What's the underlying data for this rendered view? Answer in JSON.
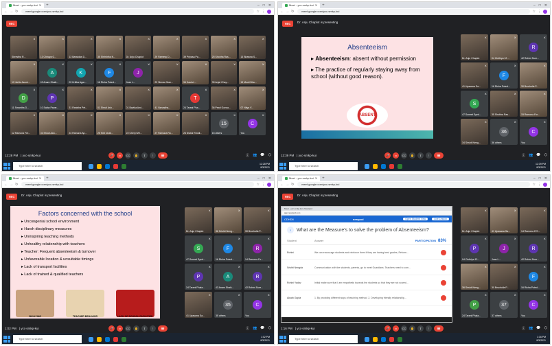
{
  "browser": {
    "tab_title": "Meet - ycc-smkp-kui",
    "url": "meet.google.com/ycc-smkp-kui"
  },
  "meet": {
    "rec_label": "REC",
    "meeting_code": "ycc-smkp-kui",
    "presenting_text": "Dr. Anju Chaplot is presenting"
  },
  "taskbar": {
    "search_placeholder": "Type here to search"
  },
  "quad1": {
    "time": "12:28 PM",
    "clock_time": "12:28 PM",
    "clock_date": "8/3/2021",
    "tiles": [
      {
        "name": "Shrestha R...",
        "kind": "photo"
      },
      {
        "name": "13 Chhaya G...",
        "kind": "photo2"
      },
      {
        "name": "13 Bansidas D...",
        "kind": "photo"
      },
      {
        "name": "35 Shrishtha N...",
        "kind": "photo2"
      },
      {
        "name": "Dr. Anju Chaplot",
        "kind": "photo"
      },
      {
        "name": "29 Ramesy D...",
        "kind": "photo2"
      },
      {
        "name": "39 Priyasa Pa...",
        "kind": "photo"
      },
      {
        "name": "25 Shobha Ras...",
        "kind": "photo2"
      },
      {
        "name": "13 Bhawna S...",
        "kind": "photo"
      },
      {
        "name": "19 Jerifa Jacob...",
        "kind": "photo2"
      },
      {
        "name": "43 Anam Shaik...",
        "kind": "letter",
        "letter": "A",
        "color": "#1a8a7a"
      },
      {
        "name": "03 Kritika Agar...",
        "kind": "letter",
        "letter": "K",
        "color": "#12a4af"
      },
      {
        "name": "16 Richa Poted...",
        "kind": "letter",
        "letter": "F",
        "color": "#1e88e5"
      },
      {
        "name": "Joan L...",
        "kind": "letter",
        "letter": "J",
        "color": "#8e24aa"
      },
      {
        "name": "22 Simran Man...",
        "kind": "photo"
      },
      {
        "name": "34 Kashvi ...",
        "kind": "photo2"
      },
      {
        "name": "05 Anjal Chay...",
        "kind": "photo"
      },
      {
        "name": "13 Mouli Bha...",
        "kind": "photo2"
      },
      {
        "name": "11 Smantha D...",
        "kind": "letter",
        "letter": "D",
        "color": "#43a047"
      },
      {
        "name": "10 Saiba Pavar...",
        "kind": "letter",
        "letter": "P",
        "color": "#5e35b1"
      },
      {
        "name": "31 Ranisha Pet...",
        "kind": "photo"
      },
      {
        "name": "01 Shruti Ash...",
        "kind": "photo2"
      },
      {
        "name": "01 Bavika And...",
        "kind": "photo"
      },
      {
        "name": "41 Narvadha...",
        "kind": "photo2"
      },
      {
        "name": "24 Tarani Pha...",
        "kind": "letter",
        "letter": "T",
        "color": "#e53935"
      },
      {
        "name": "36 Pearl Gonsa...",
        "kind": "photo"
      },
      {
        "name": "07 Nitya V...",
        "kind": "photo2"
      },
      {
        "name": "12 Ramona Fer...",
        "kind": "photo"
      },
      {
        "name": "02 Shruti Aan...",
        "kind": "photo2"
      },
      {
        "name": "24 Ramona Ap...",
        "kind": "photo"
      },
      {
        "name": "25 Kirti Chah...",
        "kind": "photo2"
      },
      {
        "name": "22 Cheryl Wr...",
        "kind": "photo"
      },
      {
        "name": "27 Ramona Ro...",
        "kind": "photo2"
      },
      {
        "name": "26 Ilmani Reddi...",
        "kind": "photo"
      },
      {
        "name": "15 others",
        "kind": "letter",
        "letter": "15",
        "color": "#5f6368"
      },
      {
        "name": "You",
        "kind": "letter",
        "letter": "C",
        "color": "#9334e6"
      }
    ]
  },
  "quad2": {
    "time": "12:39 PM",
    "clock_time": "12:39 PM",
    "clock_date": "8/3/2021",
    "slide_title": "Absenteeism",
    "bullet1_term": "Absenteeism",
    "bullet1_rest": ": absent without permission",
    "bullet2": "The practice of regularly staying away from school (without good reason).",
    "absent_label": "ABSENT",
    "side_tiles": [
      {
        "name": "Dr. Anju Chaplot",
        "kind": "photo"
      },
      {
        "name": "04 Cinthiya 12 ...",
        "kind": "photo2"
      },
      {
        "name": "42 Rohini Sure...",
        "kind": "letter",
        "letter": "R",
        "color": "#5e35b1"
      },
      {
        "name": "41 Upasana Sa...",
        "kind": "photo"
      },
      {
        "name": "16 Richa Poted...",
        "kind": "letter",
        "letter": "F",
        "color": "#1e88e5"
      },
      {
        "name": "30 Bruchulla P...",
        "kind": "photo2"
      },
      {
        "name": "47 Suneet Syed...",
        "kind": "letter",
        "letter": "S",
        "color": "#34a853"
      },
      {
        "name": "35 Shobha Ras...",
        "kind": "photo"
      },
      {
        "name": "15 Ramona For...",
        "kind": "photo2"
      },
      {
        "name": "34 Srishti Neng...",
        "kind": "photo"
      },
      {
        "name": "36 others",
        "kind": "letter",
        "letter": "36",
        "color": "#5f6368"
      },
      {
        "name": "You",
        "kind": "letter",
        "letter": "C",
        "color": "#9334e6"
      }
    ]
  },
  "quad3": {
    "time": "1:02 PM",
    "clock_time": "1:02 PM",
    "clock_date": "8/3/2021",
    "slide_title": "Factors concerned with the school",
    "bullets": [
      "Uncongenial school environment",
      "Harsh disciplinary measures",
      "Uninspiring teaching methods",
      "Unhealthy relationship with teachers",
      "Teacher: Frequent absenteeism & turnover",
      "Unfavorable location & unsuitable timings",
      "Lack of transport facilities",
      "Lack of trained & qualified teachers"
    ],
    "captions": [
      "BULLYING",
      "TEACHER BEHAVIOR",
      "LACK OF SCHOOL FACILITIES"
    ],
    "side_tiles": [
      {
        "name": "Dr. Anju Chaplot",
        "kind": "photo"
      },
      {
        "name": "36 Srishti Neng...",
        "kind": "photo2"
      },
      {
        "name": "30 Bruchulla P...",
        "kind": "photo"
      },
      {
        "name": "47 Suneet Syed...",
        "kind": "letter",
        "letter": "S",
        "color": "#34a853"
      },
      {
        "name": "16 Richa Poted...",
        "kind": "letter",
        "letter": "F",
        "color": "#1e88e5"
      },
      {
        "name": "14 Ramona Fo...",
        "kind": "letter",
        "letter": "R",
        "color": "#8e24aa"
      },
      {
        "name": "24 Tarani Phala...",
        "kind": "letter",
        "letter": "P",
        "color": "#5e35b1"
      },
      {
        "name": "43 Anam Shaik...",
        "kind": "letter",
        "letter": "A",
        "color": "#1a8a7a"
      },
      {
        "name": "42 Rohini Sure...",
        "kind": "letter",
        "letter": "R",
        "color": "#5e35b1"
      },
      {
        "name": "41 Upasana Sa...",
        "kind": "photo"
      },
      {
        "name": "35 others",
        "kind": "letter",
        "letter": "35",
        "color": "#5f6368"
      },
      {
        "name": "You",
        "kind": "letter",
        "letter": "C",
        "color": "#9334e6"
      }
    ]
  },
  "quad4": {
    "time": "1:16 PM",
    "clock_time": "1:16 PM",
    "clock_date": "8/3/2021",
    "inner_tabs": "Meet - ycc-smkp-kui | Nearpod",
    "inner_url": "app.nearpod.com",
    "inner_code": "CDHD8",
    "nearpod_logo": "nearpod",
    "inner_btn1": "Open Student View",
    "inner_btn2": "Live Lesson",
    "question": "What are the Measure's to solve the problem of Absenteeism?",
    "col_student": "Student",
    "col_answer": "Answer",
    "participation_label": "PARTICIPATION",
    "participation_pct": "83%",
    "rows": [
      {
        "student": "Rohini",
        "answer": "We can encourage students and reinforce them if they are having best grades, Reform..."
      },
      {
        "student": "Srishti Nengda",
        "answer": "Communication with the students, parents, go to meet Guardians. Teachers need to com..."
      },
      {
        "student": "Rohini Yadav",
        "answer": "Initial make sure that I am empathetic towards the students so that they are not scared..."
      },
      {
        "student": "Aksah Gupta",
        "answer": "1. By providing different ways of teaching method. 2. Developing friendly relationship..."
      }
    ],
    "side_tiles": [
      {
        "name": "Dr. Anju Chaplot",
        "kind": "photo"
      },
      {
        "name": "41 Upasana Sa...",
        "kind": "photo2"
      },
      {
        "name": "14 Ramona D'S...",
        "kind": "photo"
      },
      {
        "name": "04 Cinthiya 12...",
        "kind": "letter",
        "letter": "P",
        "color": "#5e35b1"
      },
      {
        "name": "Joan L...",
        "kind": "letter",
        "letter": "J",
        "color": "#8e24aa"
      },
      {
        "name": "42 Rohini Sure...",
        "kind": "letter",
        "letter": "R",
        "color": "#5e35b1"
      },
      {
        "name": "36 Srishti Neng...",
        "kind": "photo2"
      },
      {
        "name": "30 Bruchulla P...",
        "kind": "photo"
      },
      {
        "name": "16 Richa Poted...",
        "kind": "letter",
        "letter": "F",
        "color": "#1e88e5"
      },
      {
        "name": "24 Tarani Phala...",
        "kind": "letter",
        "letter": "P",
        "color": "#43a047"
      },
      {
        "name": "37 others",
        "kind": "letter",
        "letter": "37",
        "color": "#5f6368"
      },
      {
        "name": "You",
        "kind": "letter",
        "letter": "C",
        "color": "#9334e6"
      }
    ]
  }
}
